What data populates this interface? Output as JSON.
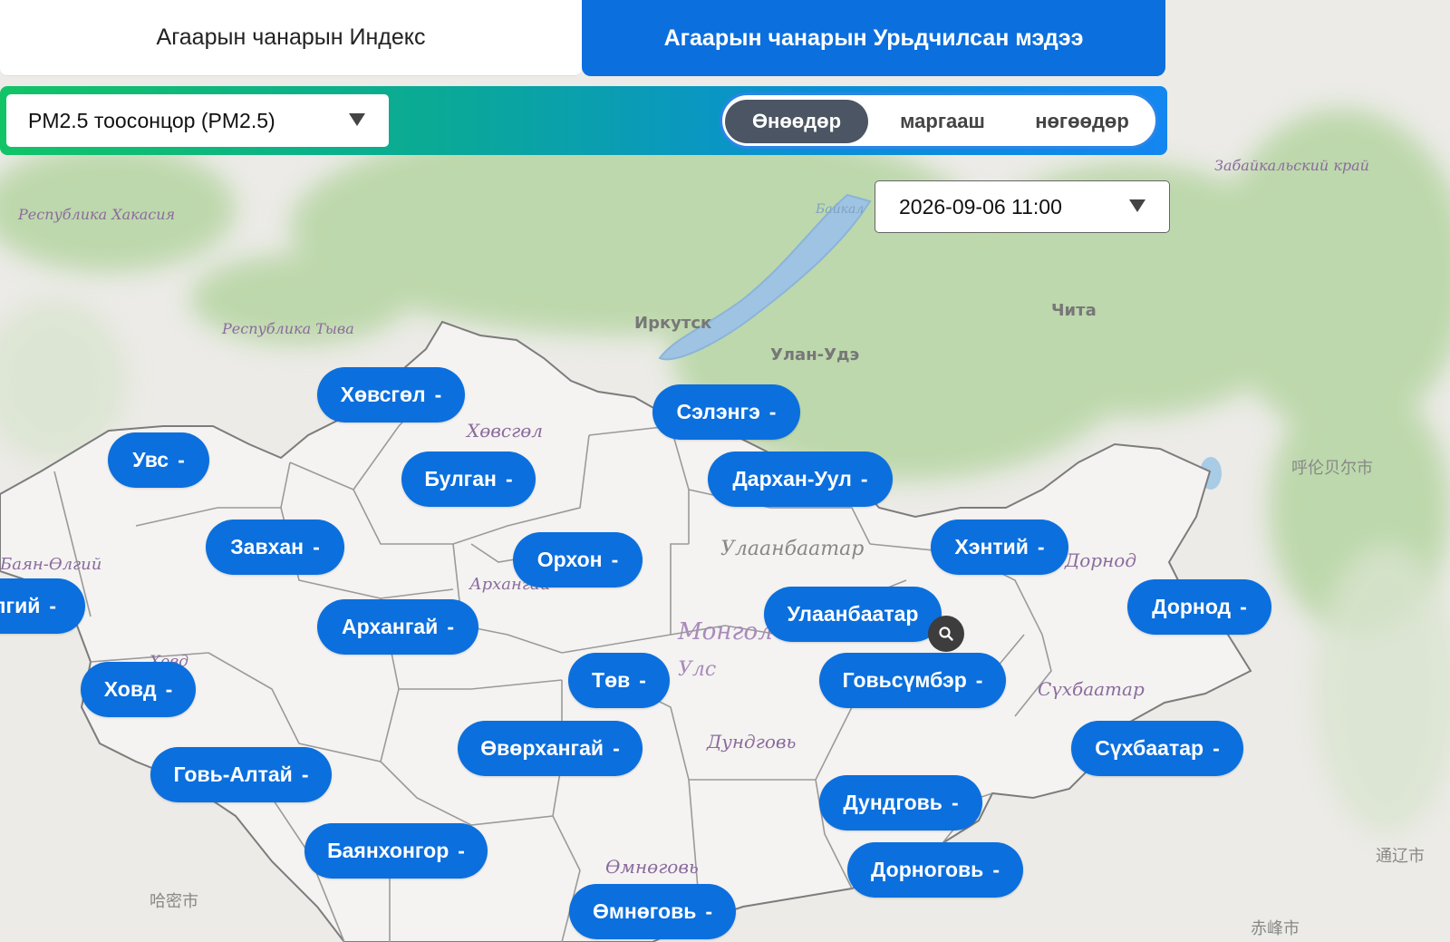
{
  "tabs": {
    "index_label": "Агаарын чанарын Индекс",
    "forecast_label": "Агаарын чанарын Урьдчилсан мэдээ"
  },
  "pollutant": {
    "selected": "PM2.5 тоосонцор (PM2.5)"
  },
  "days": {
    "today": "Өнөөдөр",
    "tomorrow": "маргааш",
    "after": "нөгөөдөр"
  },
  "datetime": {
    "selected": "2026-09-06 11:00"
  },
  "colors": {
    "accent": "#0b6fde",
    "active_day": "#4b5563",
    "gradient_start": "#12c466",
    "gradient_end": "#1386f0"
  },
  "icons": {
    "dropdown": "caret-down-icon",
    "search": "search-icon"
  },
  "map_labels": {
    "irkutsk": "Иркутск",
    "ulan_ude": "Улан-Удэ",
    "chita": "Чита",
    "baikal": "Байкал",
    "khakasia": "Республика Хакасия",
    "tyva": "Республика Тыва",
    "zabaikal": "Забайкальский край",
    "khovsgol": "Хөвсгөл",
    "ulaanbaatar": "Улаанбаатар",
    "mongol": "Монгол",
    "uls": "Улс",
    "dundgovi": "Дундговь",
    "umnugovi": "Өмнөговь",
    "sukhbaatar": "Сүхбаатар",
    "dornod": "Дорнод",
    "khovd": "Ховд",
    "arkhangai": "Архангай",
    "bayan_olgii": "Баян-Өлгий",
    "hulunbuir": "呼伦贝尔市",
    "tongliao": "通辽市",
    "chifeng": "赤峰市",
    "hami": "哈密市"
  },
  "regions": [
    {
      "name": "Хөвсгөл",
      "value": "-"
    },
    {
      "name": "Сэлэнгэ",
      "value": "-"
    },
    {
      "name": "Увс",
      "value": "-"
    },
    {
      "name": "Булган",
      "value": "-"
    },
    {
      "name": "Дархан-Уул",
      "value": "-"
    },
    {
      "name": "Завхан",
      "value": "-"
    },
    {
      "name": "Орхон",
      "value": "-"
    },
    {
      "name": "Хэнтий",
      "value": "-"
    },
    {
      "name": "лгий",
      "value": "-"
    },
    {
      "name": "Дорнод",
      "value": "-"
    },
    {
      "name": "Улаанбаатар",
      "value": ""
    },
    {
      "name": "Архангай",
      "value": "-"
    },
    {
      "name": "Ховд",
      "value": "-"
    },
    {
      "name": "Төв",
      "value": "-"
    },
    {
      "name": "Говьсүмбэр",
      "value": "-"
    },
    {
      "name": "Өвөрхангай",
      "value": "-"
    },
    {
      "name": "Сүхбаатар",
      "value": "-"
    },
    {
      "name": "Говь-Алтай",
      "value": "-"
    },
    {
      "name": "Дундговь",
      "value": "-"
    },
    {
      "name": "Баянхонгор",
      "value": "-"
    },
    {
      "name": "Дорноговь",
      "value": "-"
    },
    {
      "name": "Өмнөговь",
      "value": "-"
    }
  ]
}
